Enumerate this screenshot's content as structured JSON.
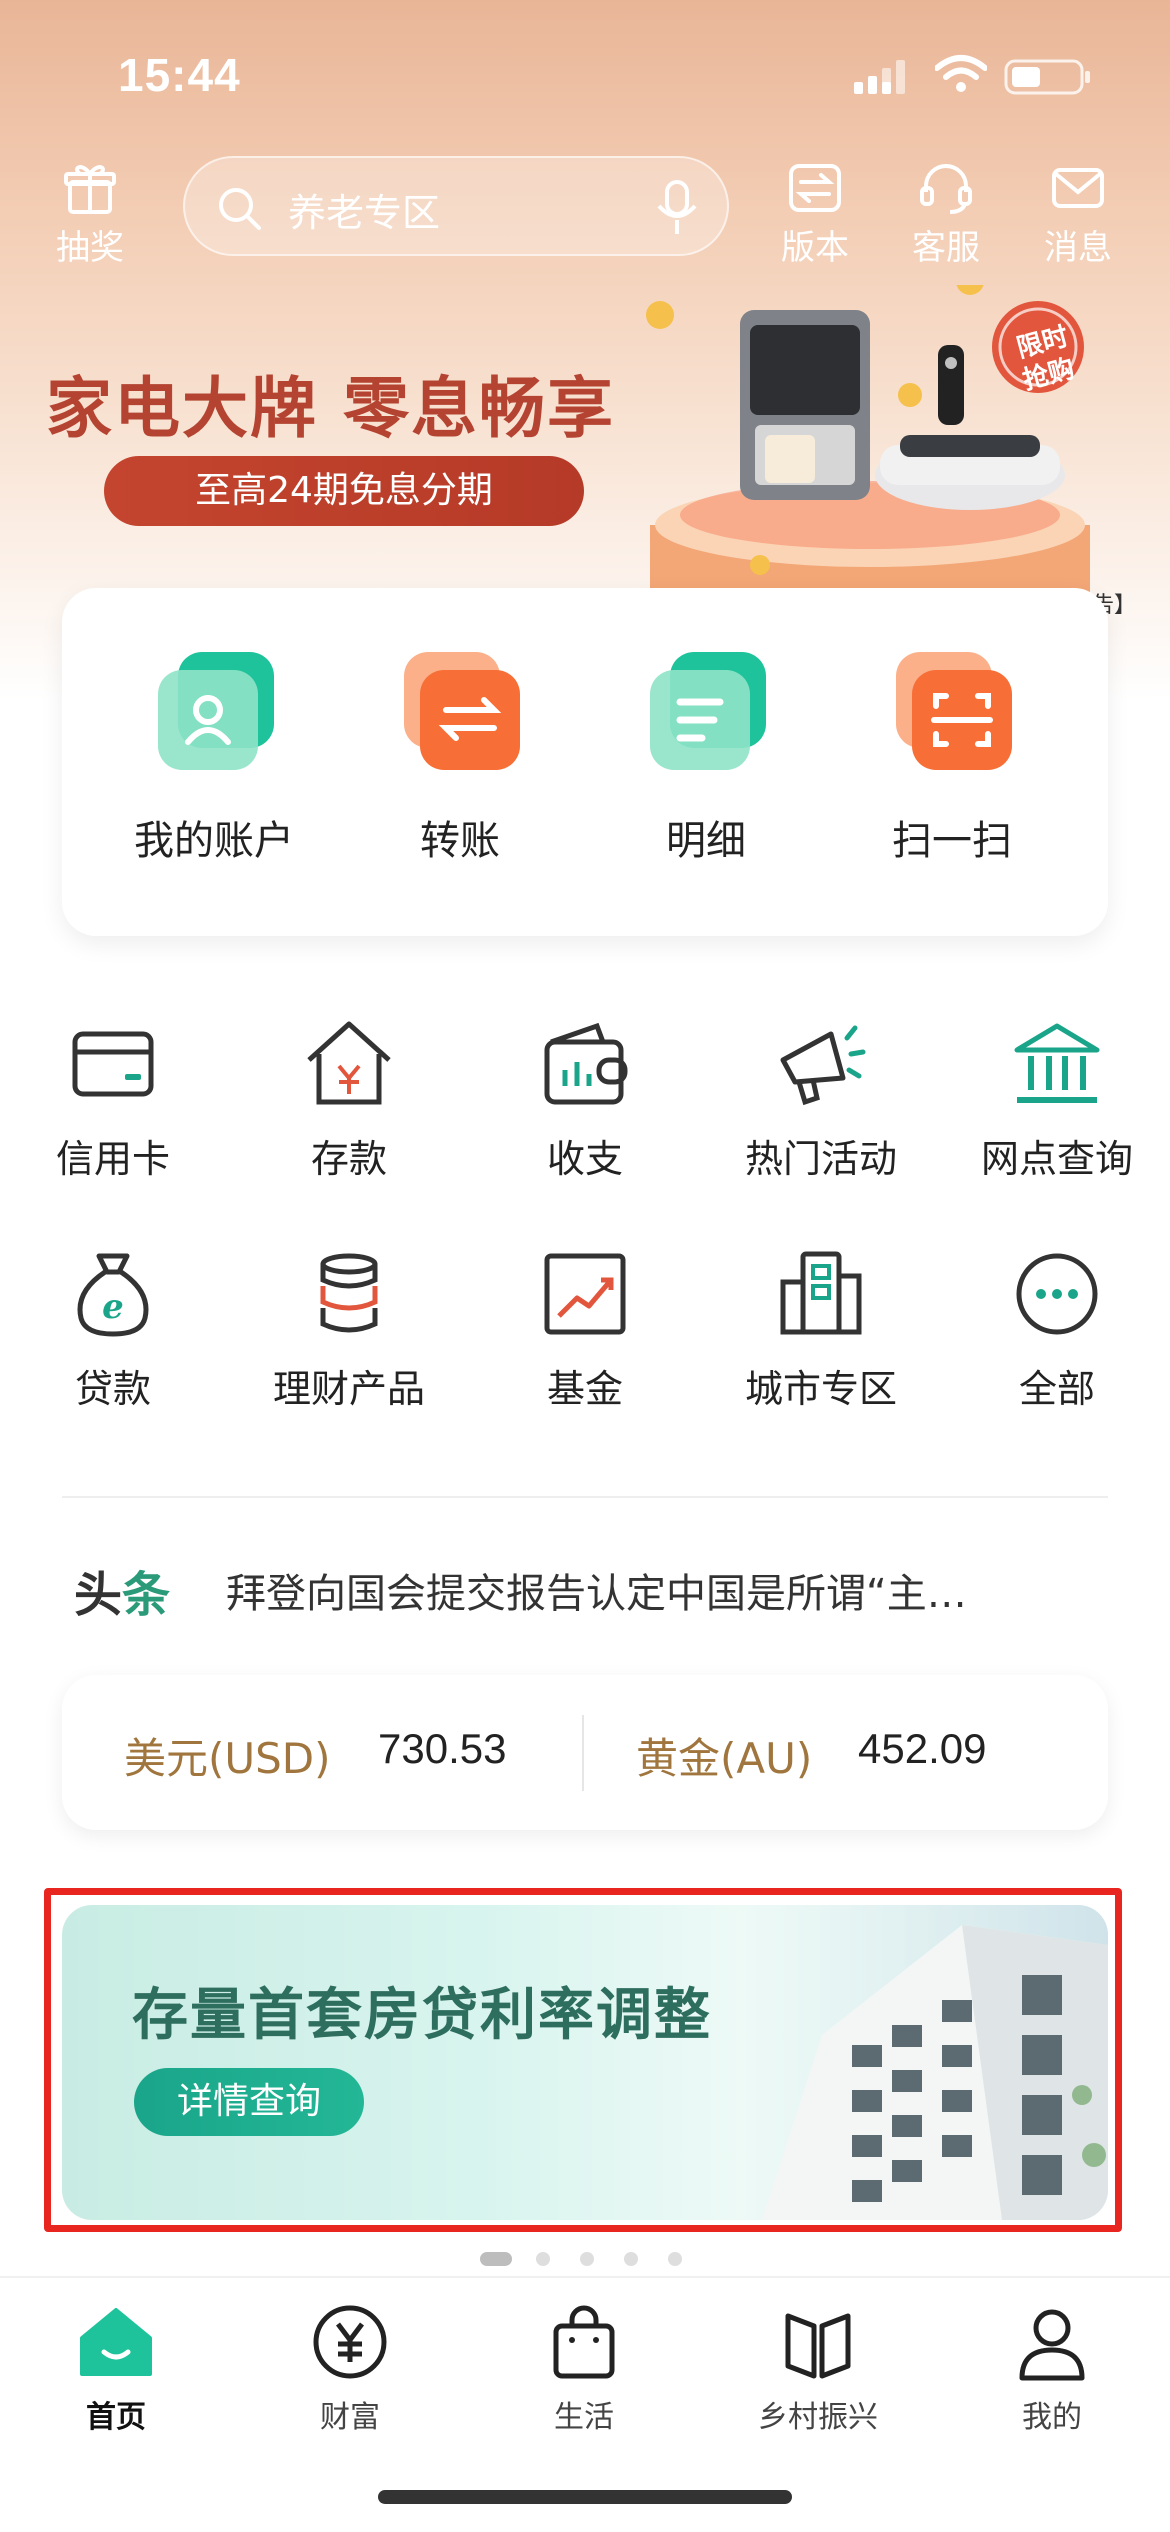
{
  "status_bar": {
    "time": "15:44"
  },
  "top_nav": {
    "lottery_label": "抽奖",
    "search_placeholder": "养老专区",
    "version_label": "版本",
    "service_label": "客服",
    "message_label": "消息"
  },
  "hero_banner": {
    "title": "家电大牌 零息畅享",
    "subtitle": "至高24期免息分期",
    "badge_line1": "限时",
    "badge_line2": "抢购",
    "ad_tag": "广告】"
  },
  "quick_actions": [
    {
      "label": "我的账户",
      "icon": "account-icon"
    },
    {
      "label": "转账",
      "icon": "transfer-icon"
    },
    {
      "label": "明细",
      "icon": "details-icon"
    },
    {
      "label": "扫一扫",
      "icon": "scan-icon"
    }
  ],
  "services": [
    {
      "label": "信用卡",
      "icon": "credit-card-icon"
    },
    {
      "label": "存款",
      "icon": "deposit-icon"
    },
    {
      "label": "收支",
      "icon": "wallet-icon"
    },
    {
      "label": "热门活动",
      "icon": "megaphone-icon"
    },
    {
      "label": "网点查询",
      "icon": "bank-branch-icon"
    },
    {
      "label": "贷款",
      "icon": "loan-bag-icon"
    },
    {
      "label": "理财产品",
      "icon": "coins-stack-icon"
    },
    {
      "label": "基金",
      "icon": "fund-chart-icon"
    },
    {
      "label": "城市专区",
      "icon": "city-building-icon"
    },
    {
      "label": "全部",
      "icon": "more-icon"
    }
  ],
  "headline": {
    "tag_part1": "头",
    "tag_part2": "条",
    "text": "拜登向国会提交报告认定中国是所谓“主…"
  },
  "rates": {
    "usd_label": "美元(USD)",
    "usd_value": "730.53",
    "gold_label": "黄金(AU)",
    "gold_value": "452.09"
  },
  "promo": {
    "title": "存量首套房贷利率调整",
    "button": "详情查询"
  },
  "pager": {
    "count": 5,
    "active": 0
  },
  "tabbar": [
    {
      "label": "首页",
      "icon": "home-icon",
      "active": true
    },
    {
      "label": "财富",
      "icon": "yuan-icon",
      "active": false
    },
    {
      "label": "生活",
      "icon": "shopping-bag-icon",
      "active": false
    },
    {
      "label": "乡村振兴",
      "icon": "book-icon",
      "active": false
    },
    {
      "label": "我的",
      "icon": "profile-icon",
      "active": false
    }
  ],
  "colors": {
    "brand_green": "#1aa58a",
    "banner_red": "#b44431",
    "rate_gold": "#a0763e",
    "highlight_frame": "#e8261f"
  }
}
